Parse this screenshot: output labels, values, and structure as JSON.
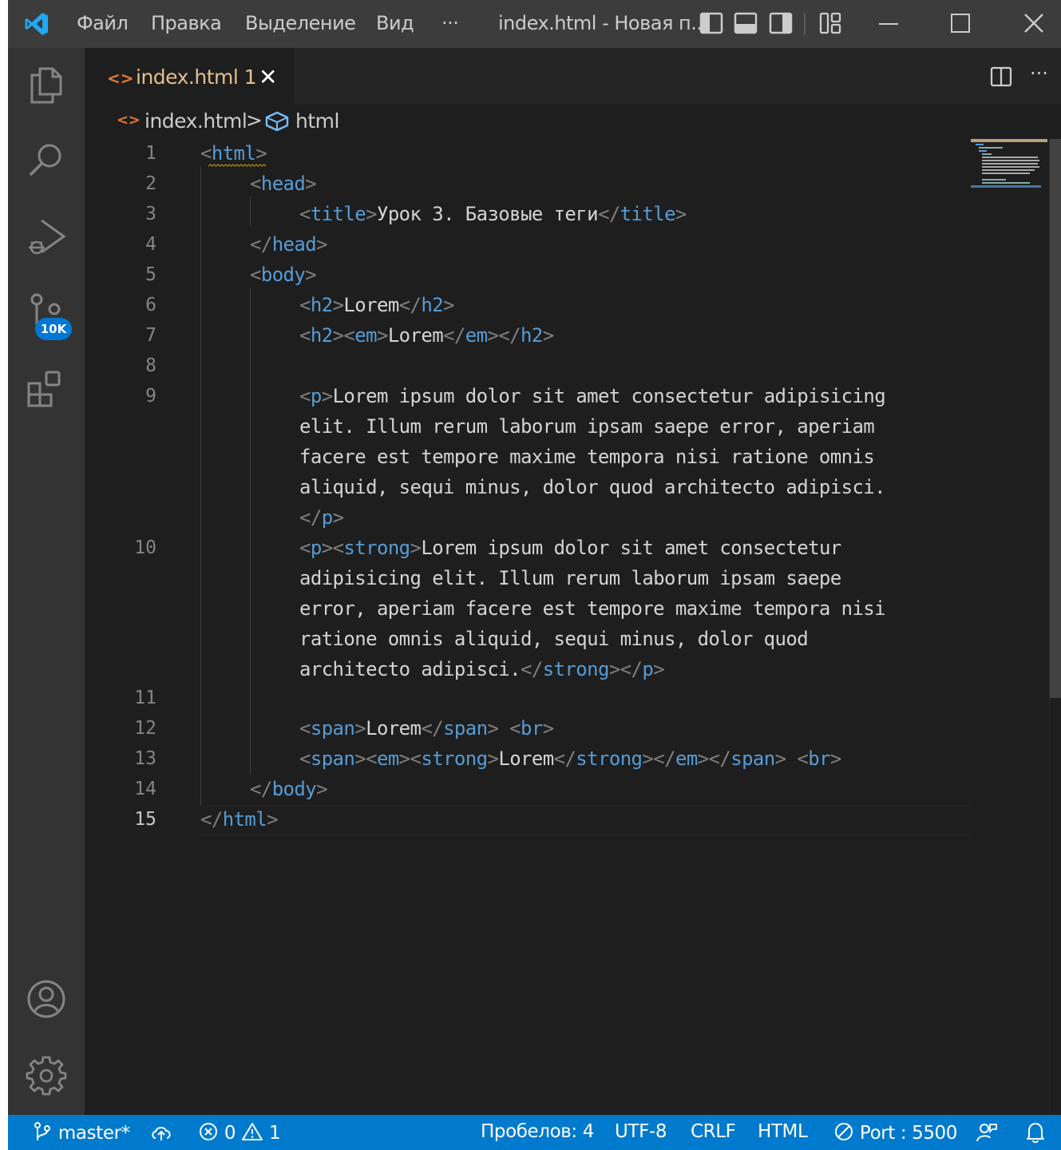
{
  "titlebar": {
    "menu": [
      "Файл",
      "Правка",
      "Выделение",
      "Вид",
      "···"
    ],
    "window_title": "index.html - Новая п..."
  },
  "activity": {
    "scm_badge": "10K"
  },
  "tab": {
    "icon": "<>",
    "name": "index.html",
    "problems": "1",
    "close": "✕"
  },
  "breadcrumbs": {
    "file": "index.html",
    "separator": ">",
    "symbol": "html"
  },
  "editor": {
    "line_numbers": [
      "1",
      "2",
      "3",
      "4",
      "5",
      "6",
      "7",
      "8",
      "9",
      "10",
      "11",
      "12",
      "13",
      "14",
      "15"
    ],
    "lines": {
      "l1": [
        "<",
        "html",
        ">"
      ],
      "l2": [
        "<",
        "head",
        ">"
      ],
      "l3": [
        "<",
        "title",
        ">",
        "Урок 3. Базовые теги",
        "</",
        "title",
        ">"
      ],
      "l4": [
        "</",
        "head",
        ">"
      ],
      "l5": [
        "<",
        "body",
        ">"
      ],
      "l6": [
        "<",
        "h2",
        ">",
        "Lorem",
        "</",
        "h2",
        ">"
      ],
      "l7": [
        "<",
        "h2",
        "><",
        "em",
        ">",
        "Lorem",
        "</",
        "em",
        "></",
        "h2",
        ">"
      ],
      "l9a": [
        "<",
        "p",
        ">",
        "Lorem ipsum dolor sit amet consectetur adipisicing"
      ],
      "l9b": "elit. Illum rerum laborum ipsam saepe error, aperiam",
      "l9c": "facere est tempore maxime tempora nisi ratione omnis",
      "l9d": "aliquid, sequi minus, dolor quod architecto adipisci.",
      "l9e": [
        "</",
        "p",
        ">"
      ],
      "l10a": [
        "<",
        "p",
        "><",
        "strong",
        ">",
        "Lorem ipsum dolor sit amet consectetur"
      ],
      "l10b": "adipisicing elit. Illum rerum laborum ipsam saepe",
      "l10c": "error, aperiam facere est tempore maxime tempora nisi",
      "l10d": "ratione omnis aliquid, sequi minus, dolor quod",
      "l10e": [
        "architecto adipisci.",
        "</",
        "strong",
        "></",
        "p",
        ">"
      ],
      "l12": [
        "<",
        "span",
        ">",
        "Lorem",
        "</",
        "span",
        "> <",
        "br",
        ">"
      ],
      "l13": [
        "<",
        "span",
        "><",
        "em",
        "><",
        "strong",
        ">",
        "Lorem",
        "</",
        "strong",
        "></",
        "em",
        "></",
        "span",
        "> <",
        "br",
        ">"
      ],
      "l14": [
        "</",
        "body",
        ">"
      ],
      "l15": [
        "</",
        "html",
        ">"
      ]
    }
  },
  "statusbar": {
    "branch": "master*",
    "errors": "0",
    "warnings": "1",
    "indent": "Пробелов: 4",
    "encoding": "UTF-8",
    "eol": "CRLF",
    "language": "HTML",
    "port": "Port : 5500"
  },
  "colors": {
    "tag": "#569cd6",
    "punct": "#808080",
    "text": "#d4d4d4",
    "statusbar": "#007acc",
    "tab_modified": "#e2c08d"
  }
}
